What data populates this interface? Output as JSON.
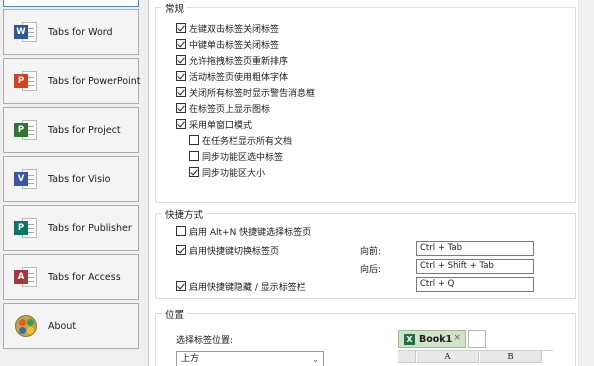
{
  "sidebar": {
    "items": [
      {
        "label": "Tabs for Word",
        "icon": "word-icon",
        "badge": "W",
        "color": "#2b579a"
      },
      {
        "label": "Tabs for PowerPoint",
        "icon": "powerpoint-icon",
        "badge": "P",
        "color": "#d04423"
      },
      {
        "label": "Tabs for Project",
        "icon": "project-icon",
        "badge": "P",
        "color": "#31752f"
      },
      {
        "label": "Tabs for Visio",
        "icon": "visio-icon",
        "badge": "V",
        "color": "#3955a3"
      },
      {
        "label": "Tabs for Publisher",
        "icon": "publisher-icon",
        "badge": "P",
        "color": "#077568"
      },
      {
        "label": "Tabs for Access",
        "icon": "access-icon",
        "badge": "A",
        "color": "#a4373a"
      },
      {
        "label": "About",
        "icon": "about-icon"
      }
    ]
  },
  "general": {
    "title": "常规",
    "options": [
      {
        "label": "左键双击标签关闭标签",
        "checked": true
      },
      {
        "label": "中键单击标签关闭标签",
        "checked": true
      },
      {
        "label": "允许拖拽标签页重新排序",
        "checked": true
      },
      {
        "label": "活动标签页使用粗体字体",
        "checked": true
      },
      {
        "label": "关闭所有标签时显示警告消息框",
        "checked": true
      },
      {
        "label": "在标签页上显示图标",
        "checked": true
      },
      {
        "label": "采用单窗口模式",
        "checked": true
      },
      {
        "label": "在任务栏显示所有文档",
        "checked": false
      },
      {
        "label": "同步功能区选中标签",
        "checked": false
      },
      {
        "label": "同步功能区大小",
        "checked": true
      }
    ]
  },
  "shortcuts": {
    "title": "快捷方式",
    "alt_n": {
      "label": "启用 Alt+N 快捷键选择标签页",
      "checked": false
    },
    "switch": {
      "label": "启用快捷键切换标签页",
      "checked": true
    },
    "toggle": {
      "label": "启用快捷键隐藏 / 显示标签栏",
      "checked": true
    },
    "prev_label": "向前:",
    "prev_value": "Ctrl + Tab",
    "next_label": "向后:",
    "next_value": "Ctrl + Shift + Tab",
    "toggle_value": "Ctrl + Q"
  },
  "position": {
    "title": "位置",
    "select_label": "选择标签位置:",
    "selected": "上方"
  },
  "preview": {
    "tab_title": "Book1",
    "tab_close": "×",
    "app_badge": "X",
    "columns": [
      "A",
      "B"
    ]
  },
  "colors": {
    "selected_border": "#4a86c8",
    "preview_tab": "#cfe3c7",
    "excel_green": "#1e7145"
  }
}
